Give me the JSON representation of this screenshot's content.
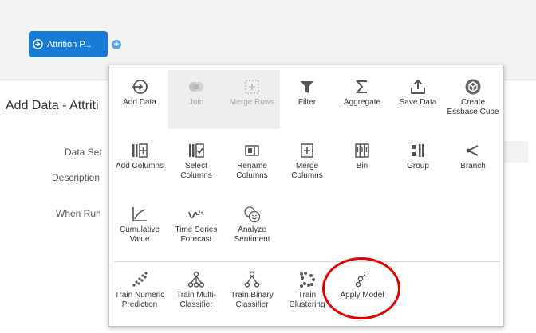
{
  "canvas": {
    "node_label": "Attrition P...",
    "add_symbol": "+"
  },
  "page": {
    "title": "Add Data - Attriti",
    "labels": {
      "data_set": "Data Set",
      "description": "Description",
      "when_run": "When Run"
    }
  },
  "menu": {
    "row1": [
      {
        "label": "Add Data",
        "icon": "add-data-icon"
      },
      {
        "label": "Join",
        "icon": "join-icon",
        "disabled": true
      },
      {
        "label": "Merge Rows",
        "icon": "merge-rows-icon",
        "disabled": true
      },
      {
        "label": "Filter",
        "icon": "filter-icon"
      },
      {
        "label": "Aggregate",
        "icon": "sigma-icon"
      },
      {
        "label": "Save Data",
        "icon": "upload-icon"
      },
      {
        "label": "Create Essbase Cube",
        "icon": "cube-icon"
      }
    ],
    "row2": [
      {
        "label": "Add Columns",
        "icon": "add-columns-icon"
      },
      {
        "label": "Select Columns",
        "icon": "select-columns-icon"
      },
      {
        "label": "Rename Columns",
        "icon": "rename-columns-icon"
      },
      {
        "label": "Merge Columns",
        "icon": "merge-columns-icon"
      },
      {
        "label": "Bin",
        "icon": "bin-icon"
      },
      {
        "label": "Group",
        "icon": "group-icon"
      },
      {
        "label": "Branch",
        "icon": "branch-icon"
      }
    ],
    "row3": [
      {
        "label": "Cumulative Value",
        "icon": "cumulative-icon"
      },
      {
        "label": "Time Series Forecast",
        "icon": "forecast-icon"
      },
      {
        "label": "Analyze Sentiment",
        "icon": "sentiment-icon"
      }
    ],
    "row4": [
      {
        "label": "Train Numeric Prediction",
        "icon": "train-numeric-icon"
      },
      {
        "label": "Train Multi-Classifier",
        "icon": "train-multi-icon"
      },
      {
        "label": "Train Binary Classifier",
        "icon": "train-binary-icon"
      },
      {
        "label": "Train Clustering",
        "icon": "train-clustering-icon"
      },
      {
        "label": "Apply Model",
        "icon": "apply-model-icon"
      }
    ]
  },
  "colors": {
    "node_blue": "#1a7bd4",
    "icon_gray": "#555555",
    "disabled_gray": "#b0b0b0",
    "highlight_red": "#e00000"
  }
}
